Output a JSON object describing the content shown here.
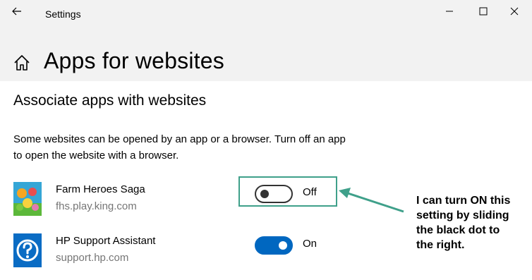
{
  "window": {
    "title": "Settings",
    "back_icon": "arrow-left-icon",
    "controls": [
      "minimize-icon",
      "maximize-icon",
      "close-icon"
    ]
  },
  "header": {
    "home_icon": "home-icon",
    "title": "Apps for websites"
  },
  "section": {
    "title": "Associate apps with websites",
    "description_line1": "Some websites can be opened by an app or a browser.  Turn off an app",
    "description_line2": "to open the website with a browser."
  },
  "apps": [
    {
      "name": "Farm Heroes Saga",
      "url": "fhs.play.king.com",
      "icon": "farm-heroes-saga-icon",
      "toggle_on": false,
      "state_label": "Off"
    },
    {
      "name": "HP Support Assistant",
      "url": "support.hp.com",
      "icon": "hp-support-assistant-icon",
      "toggle_on": true,
      "state_label": "On"
    }
  ],
  "annotation": {
    "text_line1": "I can turn ON this",
    "text_line2": "setting by sliding",
    "text_line3": "the black dot to",
    "text_line4": "the right.",
    "color": "#3fa08a"
  },
  "colors": {
    "accent": "#0067c0",
    "header_bg": "#f2f2f2",
    "secondary_text": "#767676"
  }
}
